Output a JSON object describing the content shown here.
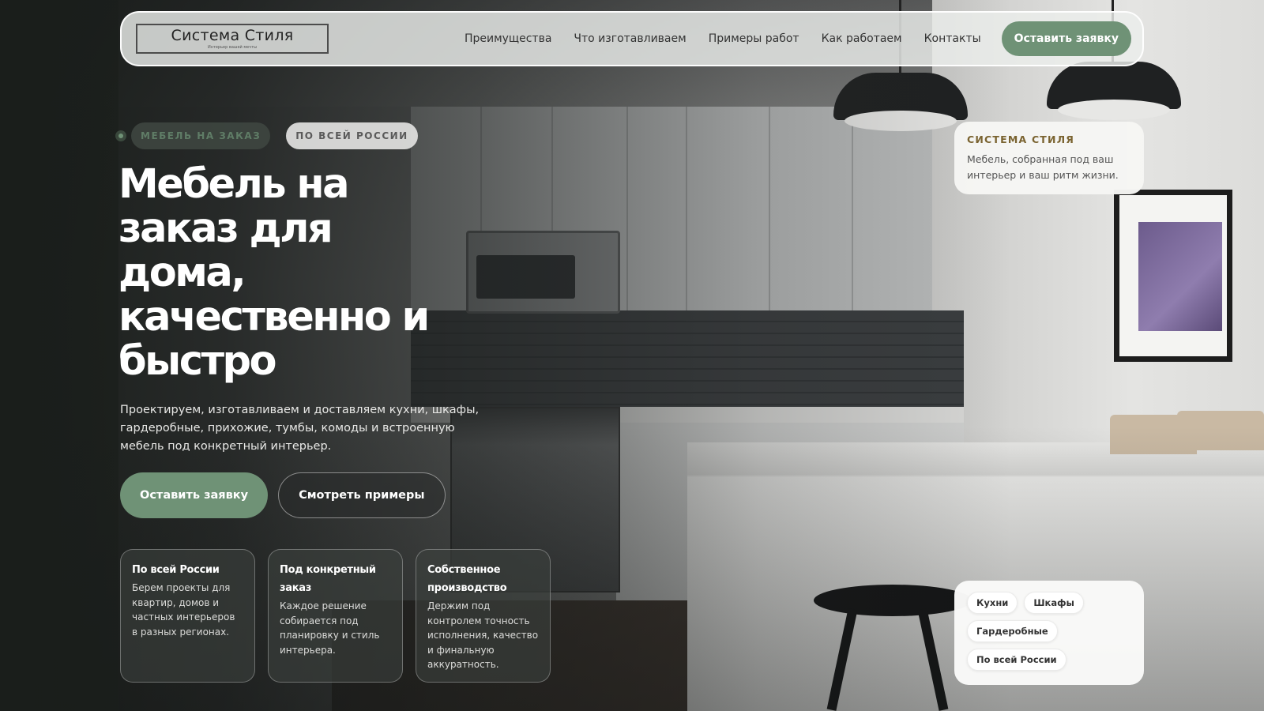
{
  "brand": {
    "name": "Система Стиля",
    "tagline": "Интерьер вашей мечты"
  },
  "nav": {
    "links": [
      "Преимущества",
      "Что изготавливаем",
      "Примеры работ",
      "Как работаем",
      "Контакты"
    ],
    "cta_label": "Оставить заявку"
  },
  "hero": {
    "badges": [
      "МЕБЕЛЬ НА ЗАКАЗ",
      "ПО ВСЕЙ РОССИИ"
    ],
    "title": "Мебель на заказ для дома, качественно и быстро",
    "description": "Проектируем, изготавливаем и доставляем кухни, шкафы, гардеробные, прихожие, тумбы, комоды и встроенную мебель под конкретный интерьер.",
    "primary_label": "Оставить заявку",
    "secondary_label": "Смотреть примеры"
  },
  "features": [
    {
      "title": "По всей России",
      "text": "Берем проекты для квартир, домов и частных интерьеров в разных регионах."
    },
    {
      "title": "Под конкретный заказ",
      "text": "Каждое решение собирается под планировку и стиль интерьера."
    },
    {
      "title": "Собственное производство",
      "text": "Держим под контролем точность исполнения, качество и финальную аккуратность."
    }
  ],
  "brand_card": {
    "title": "СИСТЕМА СТИЛЯ",
    "text": "Мебель, собранная под ваш интерьер и ваш ритм жизни."
  },
  "tags": [
    "Кухни",
    "Шкафы",
    "Гардеробные",
    "По всей России"
  ],
  "colors": {
    "accent": "#6f9276",
    "brand_card_title": "#7a6330"
  }
}
